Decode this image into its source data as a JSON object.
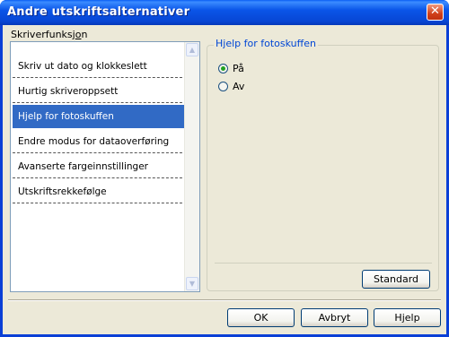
{
  "window": {
    "title": "Andre utskriftsalternativer"
  },
  "sidebar": {
    "label": "Skriverfunksjon",
    "items": [
      "Skriv ut dato og klokkeslett",
      "Hurtig skriveroppsett",
      "Hjelp for fotoskuffen",
      "Endre modus for dataoverføring",
      "Avanserte fargeinnstillinger",
      "Utskriftsrekkefølge"
    ],
    "selected_index": 2
  },
  "panel": {
    "legend": "Hjelp for fotoskuffen",
    "options": [
      "På",
      "Av"
    ],
    "selected_option": "På",
    "standard_button": "Standard"
  },
  "footer": {
    "ok": "OK",
    "cancel": "Avbryt",
    "help": "Hjelp"
  },
  "colors": {
    "titlebar": "#0a55e8",
    "selection": "#316ac5",
    "legend_text": "#0046d5",
    "dialog_bg": "#ece9d8"
  }
}
